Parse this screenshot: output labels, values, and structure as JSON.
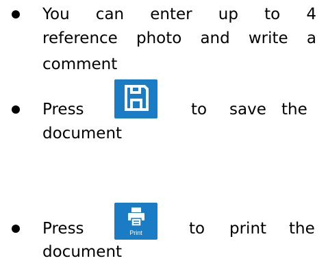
{
  "items": [
    {
      "lines": [
        [
          "You",
          "can",
          "enter",
          "up",
          "to",
          "4"
        ],
        [
          "reference",
          "photo",
          "and",
          "write",
          "a"
        ],
        [
          "comment"
        ]
      ]
    },
    {
      "before": "Press",
      "after_words": [
        "to",
        "save",
        "the"
      ],
      "continuation": "document",
      "icon": "save-icon"
    },
    {
      "before": "Press",
      "after_words": [
        "to",
        "print",
        "the"
      ],
      "continuation": "document",
      "icon": "print-icon",
      "icon_caption": "Print"
    }
  ],
  "colors": {
    "icon_background": "#1a7cc4",
    "icon_foreground": "#ffffff"
  }
}
